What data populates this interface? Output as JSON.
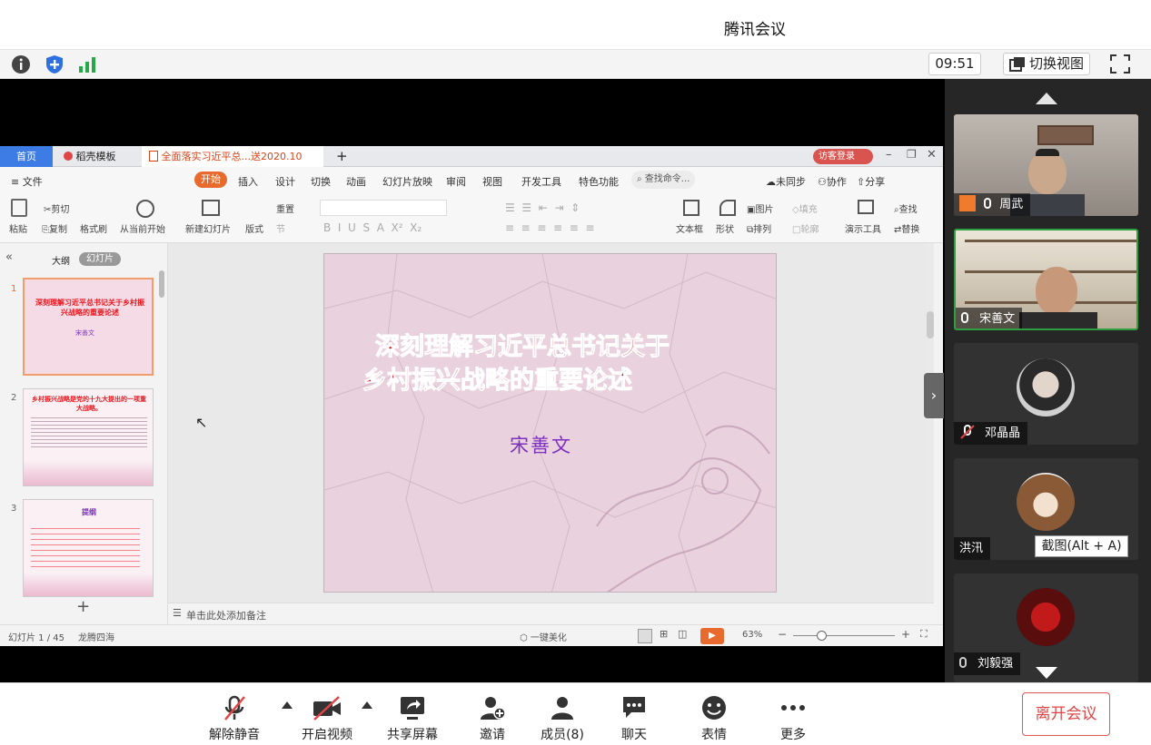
{
  "app": {
    "title": "腾讯会议"
  },
  "toolbar": {
    "clock": "09:51",
    "switch_view": "切换视图"
  },
  "wps": {
    "tabs": {
      "home": "首页",
      "templates": "稻壳模板",
      "doc": "全面落实习近平总...送2020.10",
      "add": "+"
    },
    "login": "访客登录",
    "menu": {
      "file": "文件",
      "start": "开始",
      "insert": "插入",
      "design": "设计",
      "switch": "切换",
      "animation": "动画",
      "slideshow": "幻灯片放映",
      "review": "审阅",
      "view": "视图",
      "devtools": "开发工具",
      "features": "特色功能",
      "search": "查找命令...",
      "unsynced": "未同步",
      "collab": "协作",
      "share": "分享"
    },
    "ribbon": {
      "paste": "粘贴",
      "cut": "剪切",
      "copy": "复制",
      "format_painter": "格式刷",
      "from_current": "从当前开始",
      "new_slide": "新建幻灯片",
      "layout": "版式",
      "reset": "重置",
      "section": "节",
      "textbox": "文本框",
      "shape": "形状",
      "picture": "图片",
      "fill": "填充",
      "arrange": "排列",
      "outline": "轮廓",
      "presentation_tools": "演示工具",
      "find": "查找",
      "replace": "替换"
    },
    "panel_tabs": {
      "outline": "大纲",
      "slides": "幻灯片"
    },
    "thumb1": {
      "title": "深刻理解习近平总书记关于乡村振兴战略的重要论述",
      "author": "宋善文"
    },
    "thumb2": {
      "title": "乡村振兴战略是党的十九大提出的一项重大战略。"
    },
    "thumb3": {
      "title": "提纲"
    },
    "slide": {
      "title_line1": "深刻理解习近平总书记关于",
      "title_line2": "乡村振兴战略的重要论述",
      "author": "宋善文"
    },
    "notes_hint": "单击此处添加备注",
    "status": {
      "slide_count": "幻灯片 1 / 45",
      "theme": "龙腾四海",
      "beautify": "一键美化",
      "zoom": "63%"
    }
  },
  "participants": [
    {
      "name": "周武",
      "muted": false
    },
    {
      "name": "宋善文",
      "muted": false
    },
    {
      "name": "邓晶晶",
      "muted": true
    },
    {
      "name": "洪汛",
      "muted": false
    },
    {
      "name": "刘毅强",
      "muted": false
    }
  ],
  "tooltip": "截图(Alt + A)",
  "bottom": {
    "unmute": "解除静音",
    "video": "开启视频",
    "share": "共享屏幕",
    "invite": "邀请",
    "members": "成员(8)",
    "chat": "聊天",
    "emoji": "表情",
    "more": "更多",
    "leave": "离开会议"
  },
  "colors": {
    "accent_red": "#e04545",
    "wps_orange": "#e86a2c",
    "slide_title": "#e8151c",
    "slide_author": "#7b2fc0",
    "active_green": "#2ea043"
  }
}
